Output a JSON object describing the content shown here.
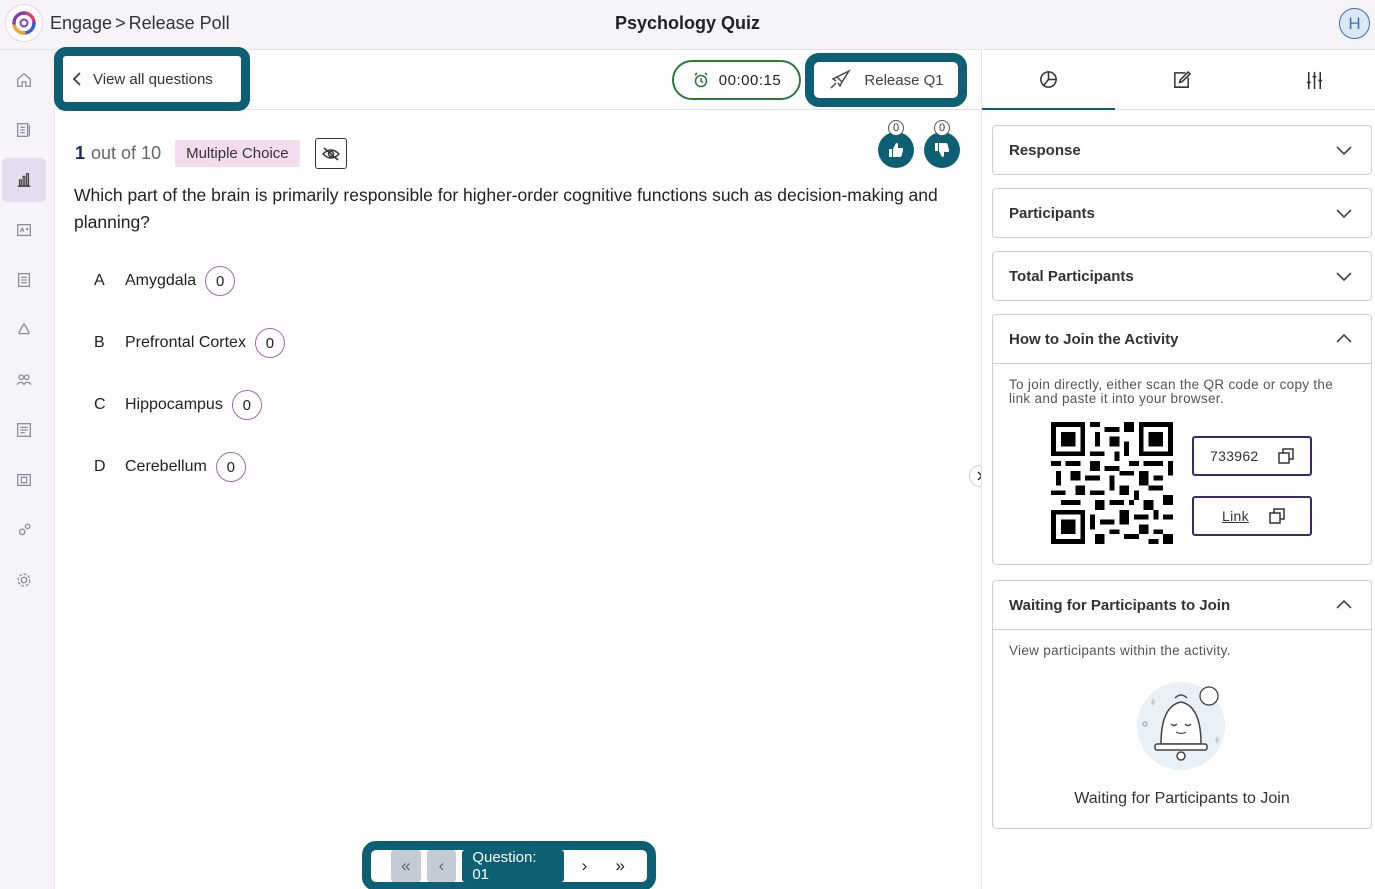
{
  "header": {
    "breadcrumb": [
      "Engage",
      "Release Poll"
    ],
    "breadcrumb_separator": ">",
    "title": "Psychology Quiz",
    "avatar_initial": "H"
  },
  "sidebar": {
    "items": [
      {
        "icon": "home-icon"
      },
      {
        "icon": "library-icon"
      },
      {
        "icon": "chart-icon",
        "active": true
      },
      {
        "icon": "grade-icon"
      },
      {
        "icon": "report-icon"
      },
      {
        "icon": "recycle-icon"
      },
      {
        "icon": "users-icon"
      },
      {
        "icon": "list-icon"
      },
      {
        "icon": "gallery-icon"
      },
      {
        "icon": "gears-icon"
      },
      {
        "icon": "settings-icon"
      }
    ]
  },
  "toolbar": {
    "view_all_label": "View all questions",
    "timer": "00:00:15",
    "release_label": "Release Q1"
  },
  "question": {
    "number": "1",
    "of_label": "out of 10",
    "type": "Multiple Choice",
    "text": "Which part of the brain is primarily responsible for higher-order cognitive functions such as decision-making and planning?",
    "likes": "0",
    "dislikes": "0",
    "options": [
      {
        "letter": "A",
        "label": "Amygdala",
        "count": "0"
      },
      {
        "letter": "B",
        "label": "Prefrontal Cortex",
        "count": "0"
      },
      {
        "letter": "C",
        "label": "Hippocampus",
        "count": "0"
      },
      {
        "letter": "D",
        "label": "Cerebellum",
        "count": "0"
      }
    ]
  },
  "pager": {
    "first": "«",
    "prev": "‹",
    "label": "Question: 01",
    "next": "›",
    "last": "»"
  },
  "panel": {
    "tabs": [
      "chart-icon",
      "edit-icon",
      "sliders-icon"
    ],
    "sections": {
      "response": "Response",
      "participants": "Participants",
      "total": "Total Participants",
      "join_title": "How to Join the Activity",
      "join_text": "To join directly, either scan the QR code or copy the link and paste it into your browser.",
      "code": "733962",
      "link_label": "Link",
      "waiting_title": "Waiting for Participants to Join",
      "waiting_text": "View participants within the activity.",
      "waiting_caption": "Waiting for Participants to Join"
    }
  },
  "colors": {
    "accent": "#0d5f73",
    "timer_border": "#2c7a3b",
    "badge_bg": "#f4dcef",
    "option_ring": "#9c6bb5"
  }
}
